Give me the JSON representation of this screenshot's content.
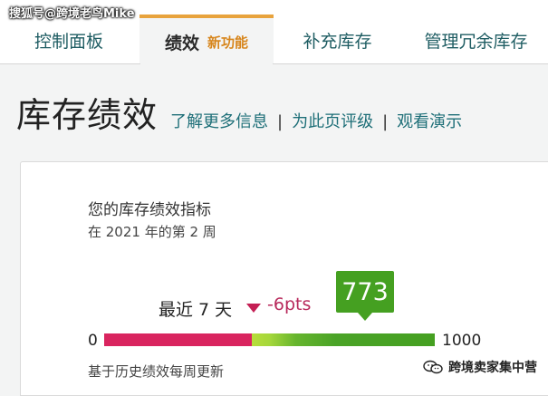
{
  "watermark_top": "搜狐号@跨境老鸟Mike",
  "tabs": [
    {
      "label": "控制面板"
    },
    {
      "label": "绩效",
      "badge": "新功能",
      "active": true
    },
    {
      "label": "补充库存"
    },
    {
      "label": "管理冗余库存"
    }
  ],
  "header": {
    "title": "库存绩效",
    "links": [
      "了解更多信息",
      "为此页评级",
      "观看演示"
    ],
    "separator": "|"
  },
  "performance": {
    "title": "您的库存绩效指标",
    "week": "在 2021 年的第 2 周",
    "recent_label": "最近 7 天",
    "delta": "-6pts",
    "score": "773",
    "score_value": 773,
    "scale_min": "0",
    "scale_max": "1000",
    "note": "基于历史绩效每周更新",
    "colors": {
      "red": "#d9245f",
      "light_green": "#b7dd3b",
      "green": "#45a021",
      "delta": "#b8295b"
    }
  },
  "watermark_bottom": "跨境卖家集中营"
}
